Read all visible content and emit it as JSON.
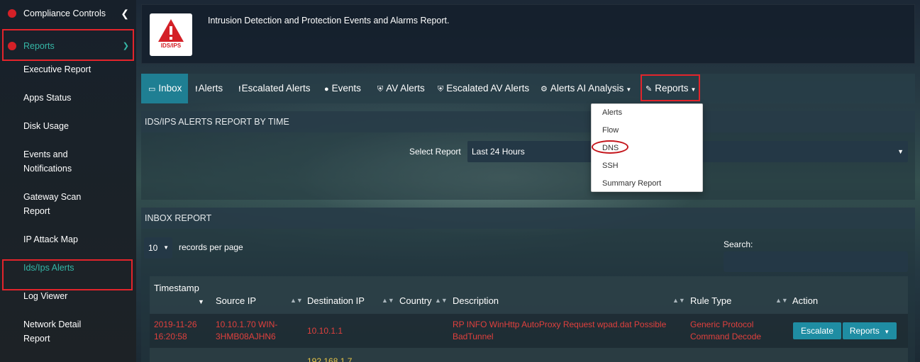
{
  "sidebar": {
    "compliance_label": "Compliance Controls",
    "reports_label": "Reports",
    "items": [
      {
        "label": "Executive Report"
      },
      {
        "label": "Apps Status"
      },
      {
        "label": "Disk Usage"
      },
      {
        "label": "Events and",
        "label2": "Notifications"
      },
      {
        "label": "Gateway Scan",
        "label2": "Report"
      },
      {
        "label": "IP Attack Map"
      },
      {
        "label": "Ids/Ips Alerts"
      },
      {
        "label": "Log Viewer"
      },
      {
        "label": "Network Detail",
        "label2": "Report"
      }
    ]
  },
  "header": {
    "title": "Intrusion Detection and Protection Events and Alarms Report.",
    "logo_text": "IDS/IPS"
  },
  "tabs": {
    "inbox": "Inbox",
    "alerts": "Alerts",
    "escalated_alerts": "Escalated Alerts",
    "events": "Events",
    "av_alerts": "AV Alerts",
    "escalated_av_alerts": "Escalated AV Alerts",
    "ai_analysis": "Alerts AI Analysis",
    "reports": "Reports"
  },
  "reports_menu": [
    "Alerts",
    "Flow",
    "DNS",
    "SSH",
    "Summary Report"
  ],
  "time_panel": {
    "title": "IDS/IPS ALERTS REPORT BY TIME",
    "select_label": "Select Report",
    "select_value": "Last 24 Hours"
  },
  "inbox_panel": {
    "title": "INBOX REPORT",
    "records_value": "10",
    "records_label": "records per page",
    "search_label": "Search:",
    "search_value": ""
  },
  "table": {
    "columns": [
      "Timestamp",
      "Source IP",
      "Destination IP",
      "Country",
      "Description",
      "Rule Type",
      "Action"
    ],
    "rows": [
      {
        "timestamp": "2019-11-26",
        "timestamp2": "16:20:58",
        "source_ip": "10.10.1.70 WIN-",
        "source_ip2": "3HMB08AJHN6",
        "destination_ip": "10.10.1.1",
        "country": "",
        "description": "RP INFO WinHttp AutoProxy Request wpad.dat Possible",
        "description2": "BadTunnel",
        "rule_type": "Generic Protocol",
        "rule_type2": "Command Decode",
        "escalate_label": "Escalate",
        "reports_label": "Reports"
      },
      {
        "destination_ip": "192.168.1.7"
      }
    ]
  },
  "colors": {
    "accent": "#1f8da3",
    "highlight": "#e3242b",
    "alert_text": "#e0403d",
    "active_text": "#35b6a6"
  }
}
